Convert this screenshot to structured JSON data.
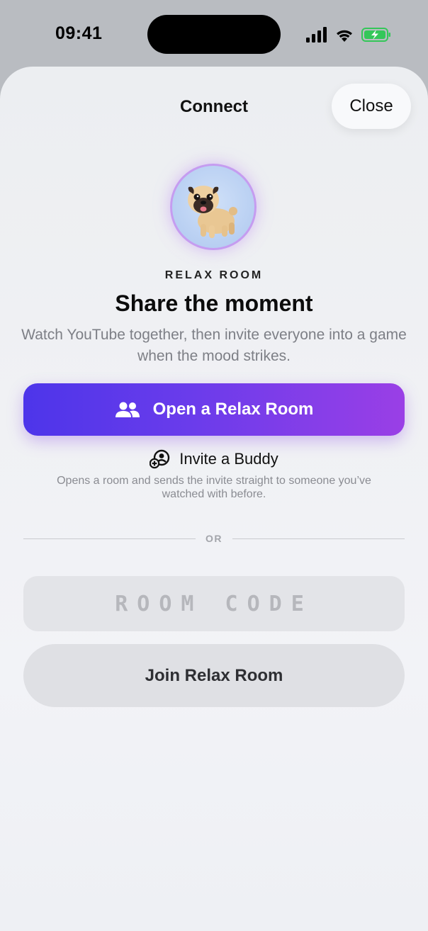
{
  "status_bar": {
    "time": "09:41",
    "icons": [
      "signal-icon",
      "wifi-icon",
      "battery-charging-icon"
    ],
    "battery_color": "#34c759"
  },
  "header": {
    "title": "Connect",
    "close_label": "Close"
  },
  "hero": {
    "avatar_icon": "pug-avatar-icon",
    "eyebrow": "RELAX ROOM",
    "headline": "Share the moment",
    "subtitle": "Watch YouTube together, then invite everyone into a game when the mood strikes."
  },
  "actions": {
    "open_room_label": "Open a Relax Room",
    "open_room_icon": "people-icon",
    "invite_label": "Invite a Buddy",
    "invite_icon": "add-buddy-icon",
    "invite_note": "Opens a room and sends the invite straight to someone you’ve watched with before."
  },
  "divider": {
    "label": "OR"
  },
  "join": {
    "code_placeholder": "ROOM CODE",
    "code_value": "",
    "join_label": "Join Relax Room"
  },
  "colors": {
    "primary_gradient_start": "#4d35ea",
    "primary_gradient_end": "#9a3fe6",
    "avatar_ring": "#c59cf0"
  }
}
